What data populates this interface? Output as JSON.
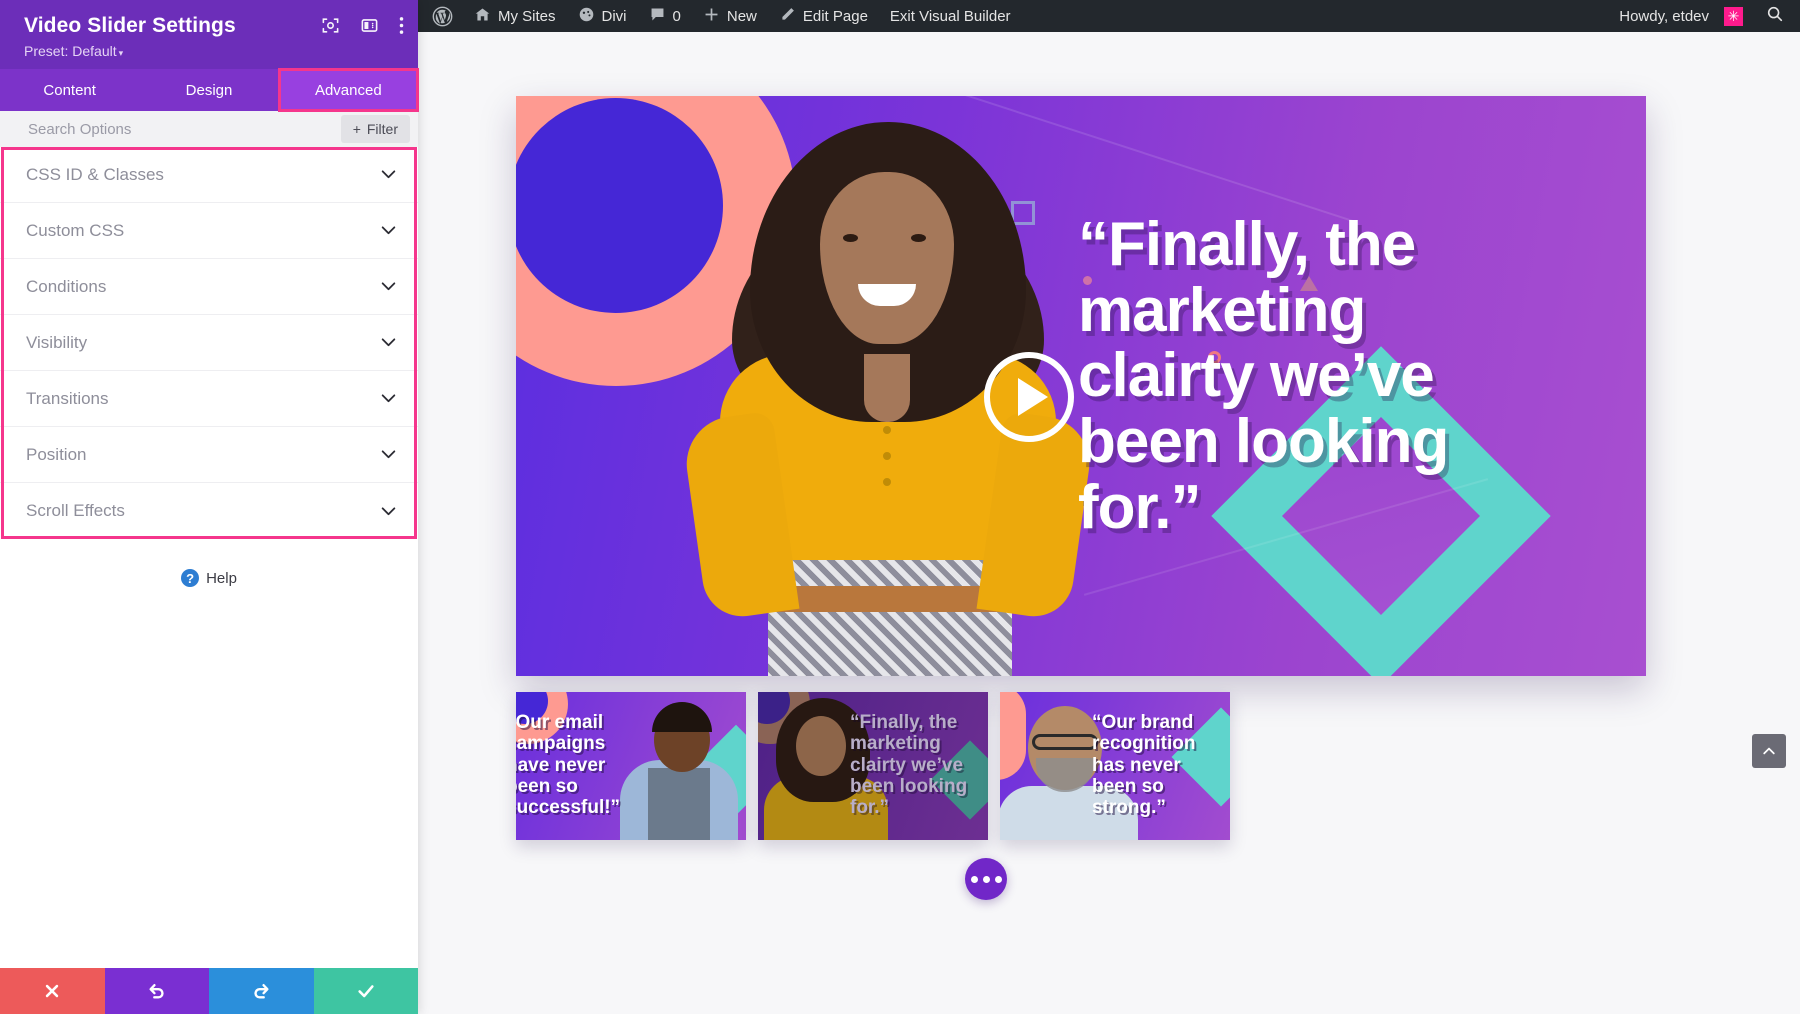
{
  "admin_bar": {
    "logo_icon": "wordpress-icon",
    "items": [
      {
        "label": "My Sites",
        "icon": "sites-icon"
      },
      {
        "label": "Divi",
        "icon": "divi-icon"
      },
      {
        "label": "0",
        "icon": "comment-icon"
      },
      {
        "label": "New",
        "icon": "plus-icon"
      },
      {
        "label": "Edit Page",
        "icon": "pencil-icon"
      },
      {
        "label": "Exit Visual Builder",
        "icon": ""
      }
    ],
    "howdy": "Howdy, etdev",
    "avatar_glyph": "✳",
    "search_icon": "search-icon"
  },
  "panel": {
    "title": "Video Slider Settings",
    "preset": "Preset: Default",
    "preset_caret": "▾",
    "header_icons": [
      "focus-target-icon",
      "panel-layout-icon",
      "kebab-menu-icon"
    ],
    "tabs": [
      {
        "label": "Content",
        "active": false
      },
      {
        "label": "Design",
        "active": false
      },
      {
        "label": "Advanced",
        "active": true
      }
    ],
    "search": {
      "placeholder": "Search Options",
      "value": ""
    },
    "filter_button": {
      "label": "Filter",
      "plus": "+"
    },
    "sections": [
      {
        "label": "CSS ID & Classes"
      },
      {
        "label": "Custom CSS"
      },
      {
        "label": "Conditions"
      },
      {
        "label": "Visibility"
      },
      {
        "label": "Transitions"
      },
      {
        "label": "Position"
      },
      {
        "label": "Scroll Effects"
      }
    ],
    "help": {
      "label": "Help",
      "glyph": "?"
    },
    "footer": [
      {
        "name": "close",
        "glyph": "✕",
        "color": "#ed5a5a"
      },
      {
        "name": "undo",
        "glyph": "↺",
        "color": "#7a2fd2"
      },
      {
        "name": "redo",
        "glyph": "↻",
        "color": "#2b8fdb"
      },
      {
        "name": "save",
        "glyph": "✓",
        "color": "#3ec5a2"
      }
    ],
    "highlight_color": "#f5368c"
  },
  "canvas": {
    "hero": {
      "headline": "“Finally, the marketing clairty we’ve been looking for.”",
      "play_button": "play-icon"
    },
    "thumbnails": [
      {
        "quote": "“Our email campaigns have never been so successful!”",
        "dimmed": false
      },
      {
        "quote": "“Finally, the marketing clairty we’ve been looking for.”",
        "dimmed": true
      },
      {
        "quote": "“Our brand recognition has never been so strong.”",
        "dimmed": false
      }
    ],
    "dots_button": "slider-options-icon",
    "scroll_top_button": "scroll-to-top-icon"
  }
}
